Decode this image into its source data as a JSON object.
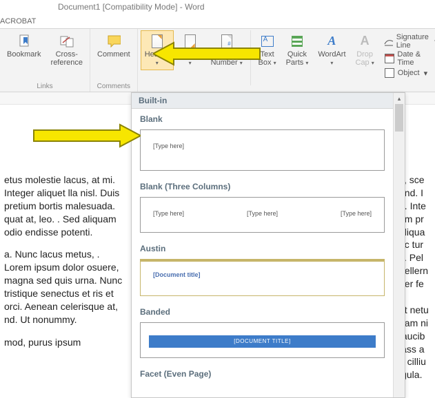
{
  "window": {
    "title": "Document1 [Compatibility Mode] - Word"
  },
  "tabs": {
    "acrobat": "ACROBAT"
  },
  "ribbon": {
    "bookmark": "Bookmark",
    "crossref": "Cross-\nreference",
    "comment": "Comment",
    "header": "Header",
    "footer": "Footer",
    "pagenum": "Page\nNumber",
    "textbox": "Text\nBox",
    "quickparts": "Quick\nParts",
    "wordart": "WordArt",
    "dropcap": "Drop\nCap",
    "sigline": "Signature Line",
    "datetime": "Date & Time",
    "object": "Object",
    "group_links": "Links",
    "group_comments": "Comments"
  },
  "gallery": {
    "category": "Built-in",
    "items": [
      {
        "label": "Blank",
        "ph": "[Type here]"
      },
      {
        "label": "Blank (Three Columns)",
        "ph": "[Type here]"
      },
      {
        "label": "Austin",
        "doc_title": "[Document title]"
      },
      {
        "label": "Banded",
        "banner": "[DOCUMENT TITLE]"
      },
      {
        "label": "Facet (Even Page)"
      }
    ]
  },
  "doc": {
    "left": [
      "etus molestie lacus, at mi. Integer aliquet lla nisl. Duis pretium bortis malesuada. quat at, leo. . Sed aliquam odio endisse potenti.",
      "a. Nunc lacus metus, . Lorem ipsum dolor osuere, magna sed quis urna. Nunc  tristique senectus et ris et orci. Aenean celerisque at, nd. Ut nonummy.",
      "mod, purus ipsum"
    ],
    "right": "s, sce\nend. I\na. Inte\nam pr\naliqua\nac tur\ns. Pel\npellern\nper fe\n\net netu\nuam ni\nfaucib\nlass a\nd cilliu\nigula."
  }
}
